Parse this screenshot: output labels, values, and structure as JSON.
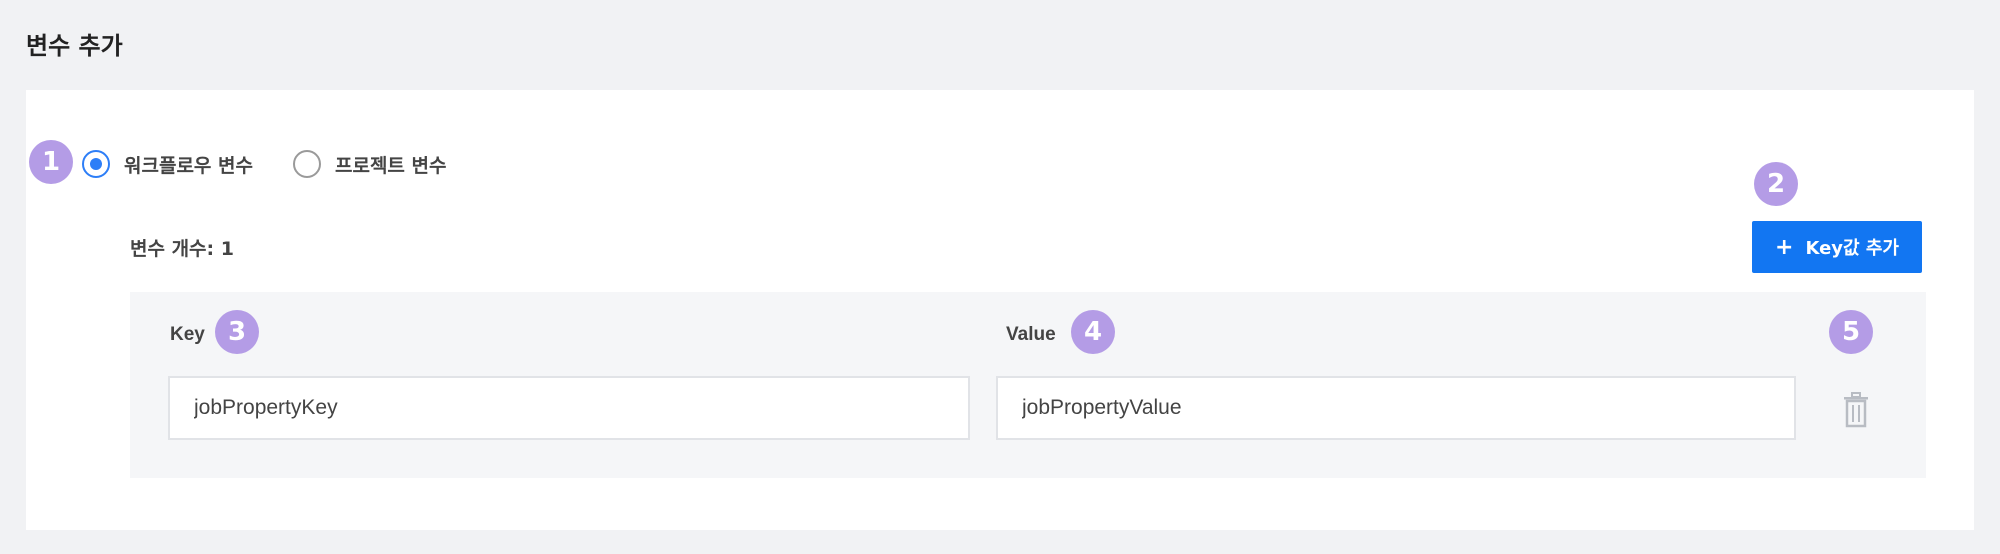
{
  "section": {
    "title": "변수 추가"
  },
  "variable_type": {
    "options": [
      {
        "label": "워크플로우 변수",
        "selected": true
      },
      {
        "label": "프로젝트 변수",
        "selected": false
      }
    ]
  },
  "variables": {
    "count_label": "변수 개수: 1",
    "add_key_button": {
      "icon": "plus-icon",
      "label": "Key값 추가"
    },
    "columns": {
      "key": "Key",
      "value": "Value"
    },
    "rows": [
      {
        "key": "jobPropertyKey",
        "value": "jobPropertyValue",
        "delete_icon": "trash-icon"
      }
    ]
  },
  "badges": [
    "1",
    "2",
    "3",
    "4",
    "5"
  ],
  "colors": {
    "accent": "#1276f2",
    "radio_checked": "#2d7ef7",
    "badge": "#b49ce6",
    "panel_bg": "#f5f6f8",
    "page_bg": "#f1f2f4"
  }
}
